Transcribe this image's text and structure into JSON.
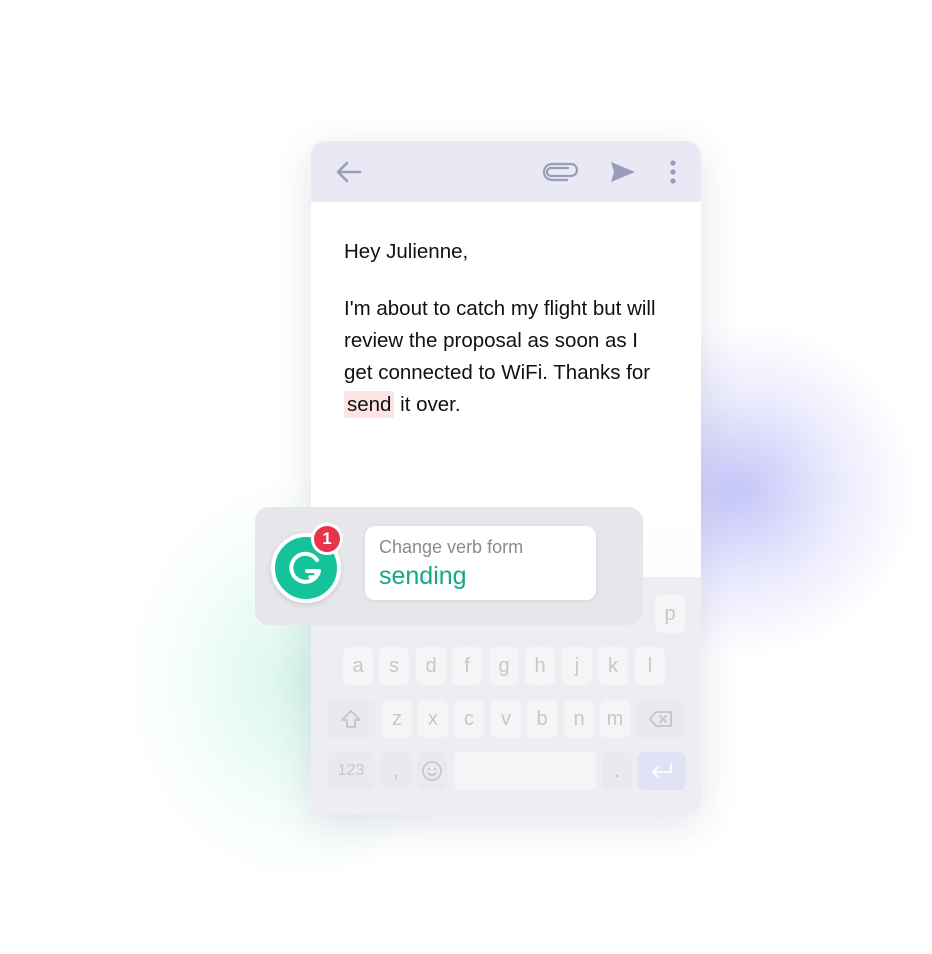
{
  "toolbar": {
    "icons": [
      "back-arrow-icon",
      "paperclip-icon",
      "send-icon",
      "more-vertical-icon"
    ]
  },
  "email": {
    "greeting": "Hey Julienne,",
    "body_part1": "I'm about to catch my flight but will review the proposal as soon as I get connected to WiFi. Thanks for ",
    "flagged_word": "send",
    "body_part2": " it over."
  },
  "suggestion": {
    "badge_count": "1",
    "label": "Change verb form",
    "replacement": "sending"
  },
  "keyboard": {
    "row1": [
      "p"
    ],
    "row2": [
      "a",
      "s",
      "d",
      "f",
      "g",
      "h",
      "j",
      "k",
      "l"
    ],
    "row3": [
      "z",
      "x",
      "c",
      "v",
      "b",
      "n",
      "m"
    ],
    "numbers_key": "123",
    "comma_key": ",",
    "period_key": "."
  },
  "colors": {
    "accent_green": "#15c39a",
    "badge_red": "#e8334d",
    "highlight": "#fde3e3",
    "toolbar_bg": "#e8e9f5"
  }
}
